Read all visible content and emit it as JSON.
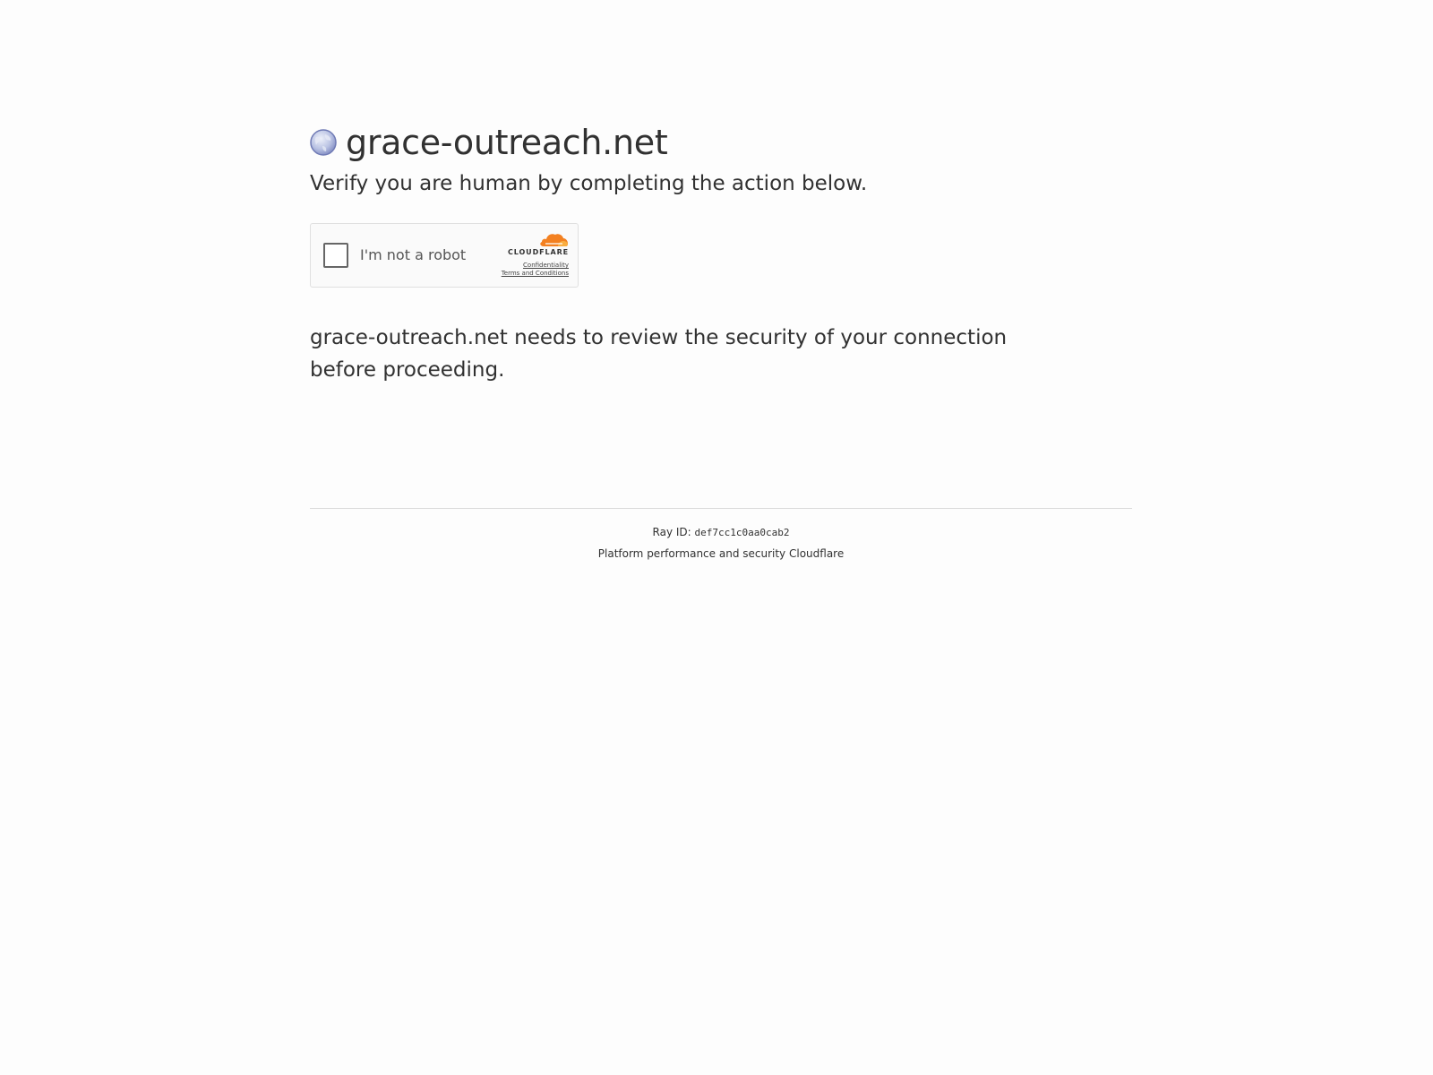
{
  "header": {
    "favicon_icon": "globe-icon",
    "site_name": "grace-outreach.net",
    "headline": "Verify you are human by completing the action below."
  },
  "challenge": {
    "checkbox_label": "I'm not a robot",
    "checked": false,
    "brand_name": "CLOUDFLARE",
    "brand_icon": "cloudflare-cloud-icon",
    "privacy_link": "Confidentiality",
    "terms_link": "Terms and Conditions",
    "brand_color": "#f38020"
  },
  "message": "grace-outreach.net needs to review the security of your connection before proceeding.",
  "footer": {
    "ray_label": "Ray ID:",
    "ray_id": "def7cc1c0aa0cab2",
    "performance_text": "Platform performance and security",
    "cloudflare_link": "Cloudflare"
  }
}
